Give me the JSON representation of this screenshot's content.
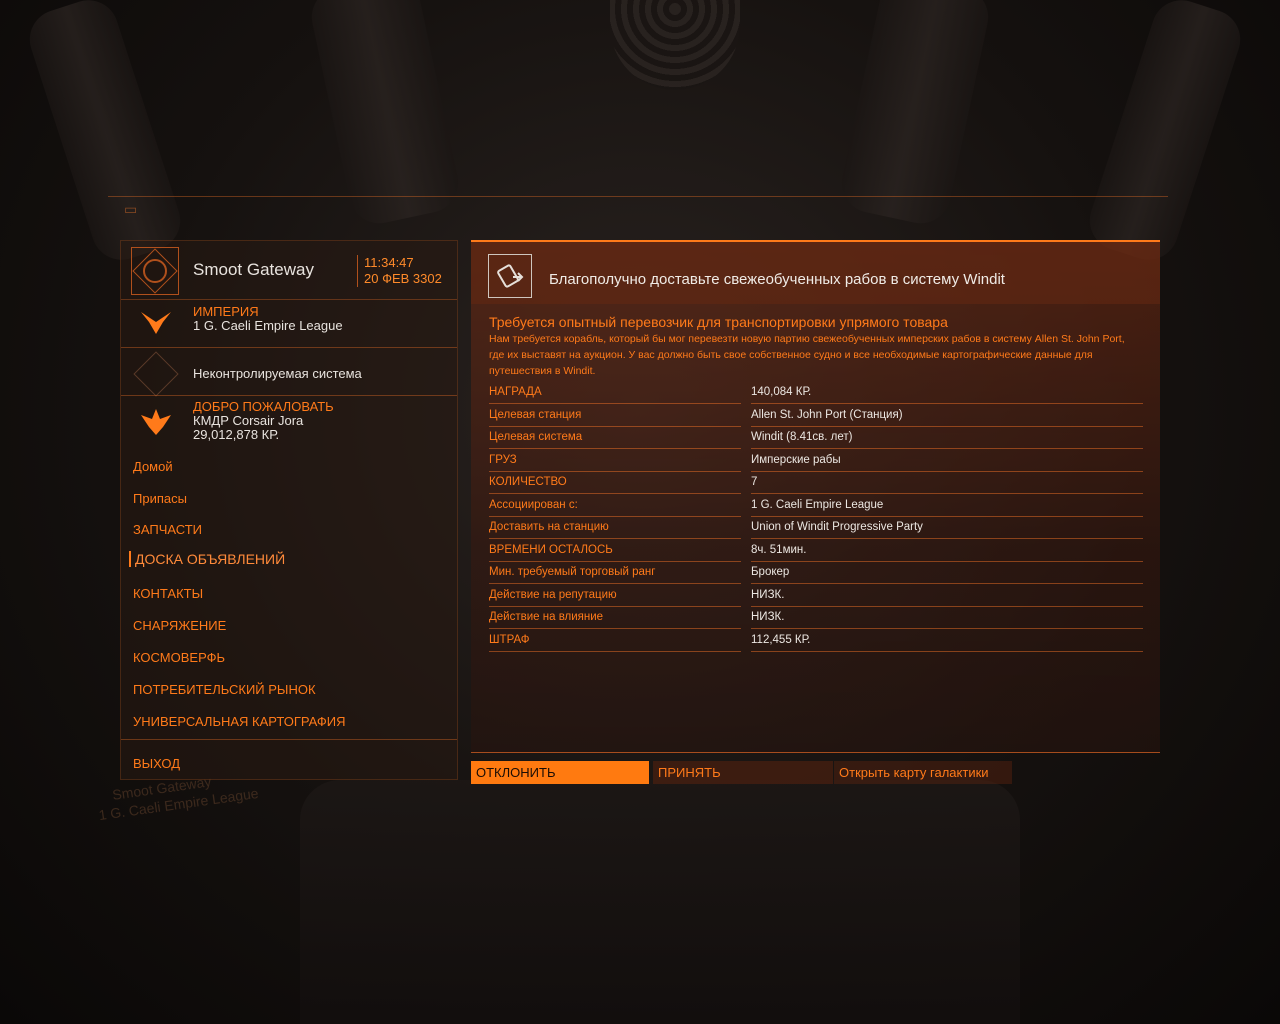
{
  "station": {
    "name": "Smoot Gateway",
    "time": "11:34:47",
    "date": "20 ФЕВ 3302"
  },
  "faction": {
    "title": "ИМПЕРИЯ",
    "name": "1 G. Caeli Empire League"
  },
  "system_status": "Неконтролируемая система",
  "welcome": {
    "title": "ДОБРО ПОЖАЛОВАТЬ",
    "commander": "КМДР Corsair Jora",
    "credits": "29,012,878 КР."
  },
  "menu": {
    "items": [
      {
        "label": "Домой"
      },
      {
        "label": "Припасы"
      },
      {
        "label": "ЗАПЧАСТИ"
      },
      {
        "label": "ДОСКА ОБЪЯВЛЕНИЙ"
      },
      {
        "label": "КОНТАКТЫ"
      },
      {
        "label": "СНАРЯЖЕНИЕ"
      },
      {
        "label": "КОСМОВЕРФЬ"
      },
      {
        "label": "ПОТРЕБИТЕЛЬСКИЙ РЫНОК"
      },
      {
        "label": "УНИВЕРСАЛЬНАЯ КАРТОГРАФИЯ"
      },
      {
        "label": "ВЫХОД"
      }
    ]
  },
  "mission": {
    "title": "Благополучно доставьте свежеобученных рабов в систему Windit",
    "subtitle": "Требуется опытный перевозчик для транспортировки упрямого товара",
    "description": "Нам требуется корабль, который бы мог перевезти новую партию свежеобученных имперских рабов в систему Allen St. John Port, где их выставят на аукцион. У вас должно быть свое собственное судно и все необходимые картографические данные для путешествия в Windit.",
    "details": [
      {
        "key": "НАГРАДА",
        "value": "140,084 КР."
      },
      {
        "key": "Целевая станция",
        "value": "Allen St. John Port (Станция)"
      },
      {
        "key": "Целевая система",
        "value": "Windit (8.41св. лет)"
      },
      {
        "key": "ГРУЗ",
        "value": "Имперские рабы"
      },
      {
        "key": "КОЛИЧЕСТВО",
        "value": "7"
      },
      {
        "key": "Ассоциирован с:",
        "value": "1 G. Caeli Empire League"
      },
      {
        "key": "Доставить на станцию",
        "value": "Union of Windit Progressive Party"
      },
      {
        "key": "ВРЕМЕНИ ОСТАЛОСЬ",
        "value": "8ч. 51мин."
      },
      {
        "key": "Мин. требуемый торговый ранг",
        "value": "Брокер"
      },
      {
        "key": "Действие на репутацию",
        "value": "НИЗК."
      },
      {
        "key": "Действие на влияние",
        "value": "НИЗК."
      },
      {
        "key": "ШТРАФ",
        "value": "112,455 КР."
      }
    ]
  },
  "actions": {
    "decline": "ОТКЛОНИТЬ",
    "accept": "ПРИНЯТЬ",
    "galaxy_map": "Открыть карту галактики"
  },
  "background": {
    "ghost_station": "Smoot Gateway",
    "ghost_faction": "1 G. Caeli Empire League"
  },
  "colors": {
    "accent": "#ff7a1a",
    "decline_bg": "#ff7a10"
  }
}
